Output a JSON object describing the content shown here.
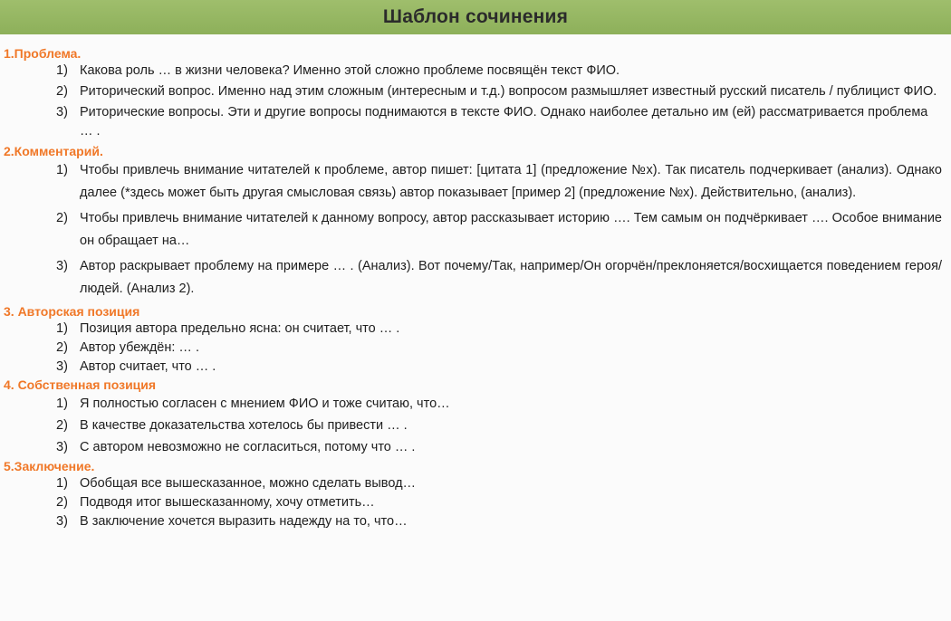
{
  "title": "Шаблон сочинения",
  "sections": [
    {
      "heading": "1.Проблема.",
      "items": [
        {
          "num": "1)",
          "text": "Какова роль … в жизни человека? Именно этой сложно проблеме посвящён текст ФИО."
        },
        {
          "num": "2)",
          "text": "Риторический вопрос. Именно над этим сложным (интересным и т.д.) вопросом размышляет известный русский писатель / публицист ФИО."
        },
        {
          "num": "3)",
          "text": "Риторические вопросы. Эти и другие вопросы поднимаются в тексте ФИО. Однако наиболее детально им (ей) рассматривается проблема … ."
        }
      ]
    },
    {
      "heading": "2.Комментарий.",
      "items": [
        {
          "num": "1)",
          "text": "Чтобы привлечь внимание читателей к проблеме, автор пишет: [цитата 1] (предложение №х). Так писатель подчеркивает (анализ). Однако далее (*здесь может быть другая смысловая связь) автор показывает [пример 2] (предложение №х). Действительно, (анализ)."
        },
        {
          "num": "2)",
          "text": "Чтобы привлечь внимание читателей к данному вопросу, автор рассказывает историю …. Тем самым он подчёркивает …. Особое внимание он обращает на…"
        },
        {
          "num": "3)",
          "text": "Автор раскрывает проблему на примере … . (Анализ). Вот почему/Так, например/Он огорчён/преклоняется/восхищается поведением героя/людей. (Анализ 2)."
        }
      ]
    },
    {
      "heading": "3. Авторская позиция",
      "items": [
        {
          "num": "1)",
          "text": "Позиция автора предельно ясна: он считает, что … ."
        },
        {
          "num": "2)",
          "text": "Автор убеждён: … ."
        },
        {
          "num": "3)",
          "text": "Автор считает, что … ."
        }
      ]
    },
    {
      "heading": "4. Собственная позиция",
      "items": [
        {
          "num": "1)",
          "text": "Я полностью согласен с мнением ФИО и тоже считаю, что…"
        },
        {
          "num": "2)",
          "text": "В качестве доказательства хотелось бы привести … ."
        },
        {
          "num": "3)",
          "text": "С автором невозможно не согласиться, потому что … ."
        }
      ]
    },
    {
      "heading": "5.Заключение.",
      "items": [
        {
          "num": "1)",
          "text": "Обобщая все вышесказанное, можно сделать вывод…"
        },
        {
          "num": "2)",
          "text": "Подводя итог вышесказанному, хочу отметить…"
        },
        {
          "num": "3)",
          "text": "В заключение хочется выразить надежду на то, что…"
        }
      ]
    }
  ],
  "colors": {
    "title_bar": "#8db05a",
    "heading": "#f07828",
    "text": "#202020"
  }
}
